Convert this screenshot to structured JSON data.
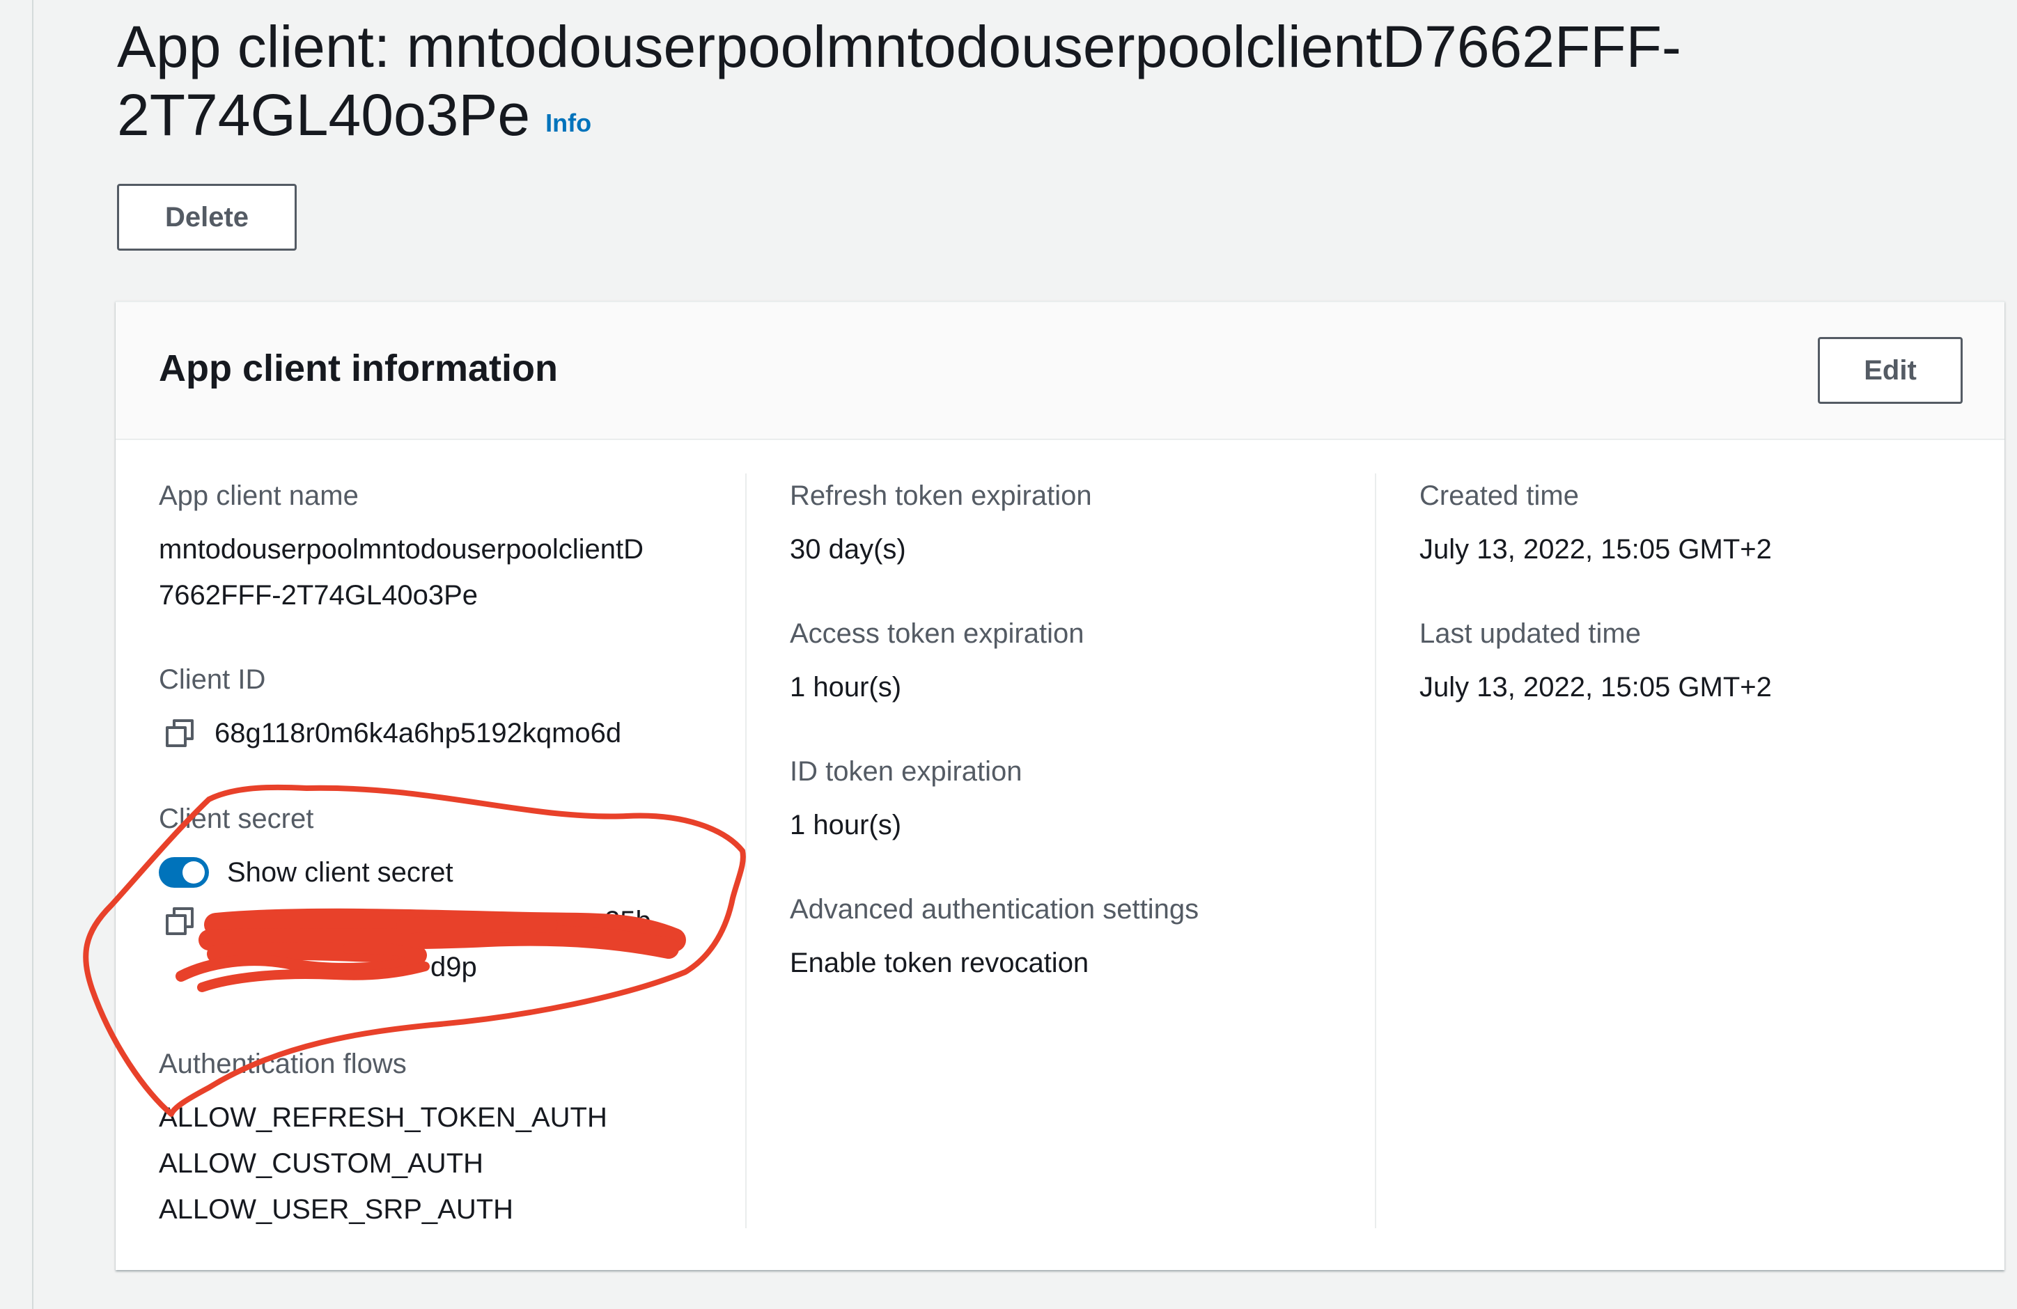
{
  "page": {
    "title": "App client: mntodouserpoolmntodouserpoolclientD7662FFF-2T74GL40o3Pe",
    "info_link": "Info",
    "delete_button": "Delete"
  },
  "card": {
    "title": "App client information",
    "edit_button": "Edit"
  },
  "fields": {
    "app_client_name": {
      "label": "App client name",
      "value_line1": "mntodouserpoolmntodouserpoolclientD",
      "value_line2": "7662FFF-2T74GL40o3Pe"
    },
    "client_id": {
      "label": "Client ID",
      "value": "68g118r0m6k4a6hp5192kqmo6d",
      "icon": "copy-icon"
    },
    "client_secret": {
      "label": "Client secret",
      "toggle_label": "Show client secret",
      "toggle_on": true,
      "value_line1_visible_tail": "25b",
      "value_line2_visible_tail": "d9p",
      "icon": "copy-icon"
    },
    "authentication_flows": {
      "label": "Authentication flows",
      "values": [
        "ALLOW_REFRESH_TOKEN_AUTH",
        "ALLOW_CUSTOM_AUTH",
        "ALLOW_USER_SRP_AUTH"
      ]
    },
    "refresh_token_expiration": {
      "label": "Refresh token expiration",
      "value": "30 day(s)"
    },
    "access_token_expiration": {
      "label": "Access token expiration",
      "value": "1 hour(s)"
    },
    "id_token_expiration": {
      "label": "ID token expiration",
      "value": "1 hour(s)"
    },
    "advanced_auth_settings": {
      "label": "Advanced authentication settings",
      "value": "Enable token revocation"
    },
    "created_time": {
      "label": "Created time",
      "value": "July 13, 2022, 15:05 GMT+2"
    },
    "last_updated_time": {
      "label": "Last updated time",
      "value": "July 13, 2022, 15:05 GMT+2"
    }
  },
  "colors": {
    "accent": "#0073bb",
    "annotation": "#e8412a",
    "background": "#f2f3f3"
  }
}
